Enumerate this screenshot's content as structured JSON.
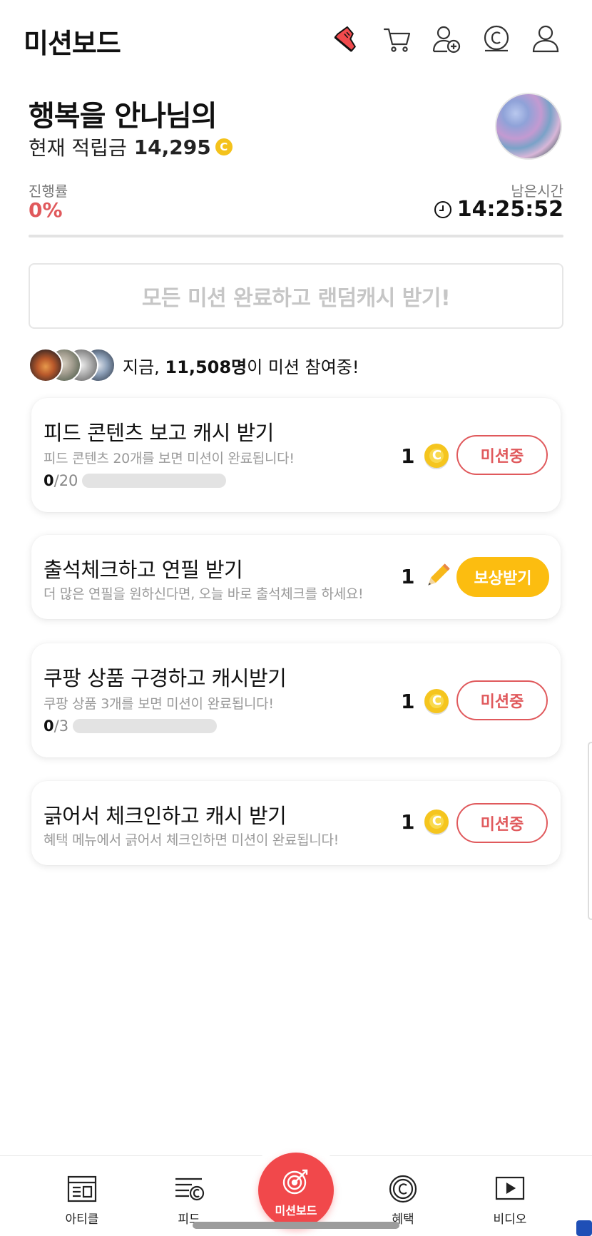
{
  "header": {
    "title": "미션보드",
    "icons": [
      "sneaker-icon",
      "cart-icon",
      "add-friend-icon",
      "cash-icon",
      "profile-icon"
    ]
  },
  "profile": {
    "name": "행복을 안나님의",
    "points_label": "현재 적립금",
    "points_value": "14,295",
    "progress_label": "진행률",
    "progress_value": "0%",
    "time_label": "남은시간",
    "time_value": "14:25:52"
  },
  "banner": {
    "all_complete_label": "모든 미션 완료하고 랜덤캐시 받기!"
  },
  "participants": {
    "prefix": "지금, ",
    "count": "11,508명",
    "suffix": "이 미션 참여중!"
  },
  "missions": [
    {
      "title": "피드 콘텐츠 보고 캐시 받기",
      "desc": "피드 콘텐츠 20개를 보면 미션이 완료됩니다!",
      "progress_current": "0",
      "progress_total": "/20",
      "progress_fraction": 0,
      "reward": "1",
      "reward_icon": "coin-icon",
      "button": "미션중"
    },
    {
      "title": "출석체크하고 연필 받기",
      "desc": "더 많은 연필을 원하신다면, 오늘 바로 출석체크를 하세요!",
      "reward": "1",
      "reward_icon": "pencil-icon",
      "button": "보상받기"
    },
    {
      "title": "쿠팡 상품 구경하고 캐시받기",
      "desc": "쿠팡 상품 3개를 보면 미션이 완료됩니다!",
      "progress_current": "0",
      "progress_total": "/3",
      "progress_fraction": 0,
      "reward": "1",
      "reward_icon": "coin-icon",
      "button": "미션중"
    },
    {
      "title": "긁어서 체크인하고 캐시 받기",
      "desc": "혜택 메뉴에서 긁어서 체크인하면 미션이 완료됩니다!",
      "reward": "1",
      "reward_icon": "coin-icon",
      "button": "미션중"
    }
  ],
  "nav": {
    "article": "아티클",
    "feed": "피드",
    "missionboard": "미션보드",
    "benefit": "혜택",
    "video": "비디오"
  },
  "colors": {
    "accent_red": "#e0595c",
    "nav_red": "#f1484b",
    "reward_yellow": "#fcbd10",
    "coin_gold": "#f5c51e"
  }
}
